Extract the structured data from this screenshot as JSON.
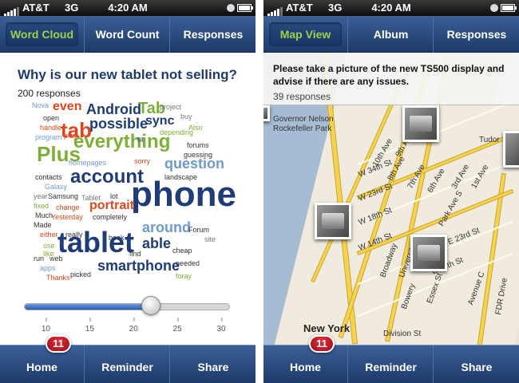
{
  "status": {
    "carrier": "AT&T",
    "network": "3G",
    "time": "4:20 AM"
  },
  "left": {
    "tabs": [
      {
        "label": "Word Cloud",
        "active": true
      },
      {
        "label": "Word Count",
        "active": false
      },
      {
        "label": "Responses",
        "active": false
      }
    ],
    "question": "Why is our new tablet not selling?",
    "responses": "200 responses",
    "cloud_words": [
      {
        "text": "Nova",
        "size": 9,
        "color": "#6d9bd1"
      },
      {
        "text": "even",
        "size": 16,
        "color": "#e0461c"
      },
      {
        "text": "Android",
        "size": 18,
        "color": "#1f3c78"
      },
      {
        "text": "Tab",
        "size": 20,
        "color": "#7db037"
      },
      {
        "text": "project",
        "size": 9,
        "color": "#7a7a7a"
      },
      {
        "text": "open",
        "size": 9,
        "color": "#333"
      },
      {
        "text": "handle",
        "size": 9,
        "color": "#e0461c"
      },
      {
        "text": "tab",
        "size": 26,
        "color": "#e0461c"
      },
      {
        "text": "possible",
        "size": 18,
        "color": "#1f3c78"
      },
      {
        "text": "sync",
        "size": 16,
        "color": "#1f3c78"
      },
      {
        "text": "buy",
        "size": 9,
        "color": "#7a7a7a"
      },
      {
        "text": "Also",
        "size": 9,
        "color": "#7db037"
      },
      {
        "text": "depending",
        "size": 9,
        "color": "#7db037"
      },
      {
        "text": "program",
        "size": 9,
        "color": "#6d9bd1"
      },
      {
        "text": "play",
        "size": 9,
        "color": "#e0461c"
      },
      {
        "text": "everything",
        "size": 24,
        "color": "#7db037"
      },
      {
        "text": "fill",
        "size": 8,
        "color": "#1f3c78"
      },
      {
        "text": "forums",
        "size": 9,
        "color": "#333"
      },
      {
        "text": "guessing",
        "size": 9,
        "color": "#333"
      },
      {
        "text": "Plus",
        "size": 26,
        "color": "#7db037"
      },
      {
        "text": "homepages",
        "size": 9,
        "color": "#6d9bd1"
      },
      {
        "text": "sorry",
        "size": 9,
        "color": "#e0461c"
      },
      {
        "text": "question",
        "size": 18,
        "color": "#6d9bd1"
      },
      {
        "text": "contacts",
        "size": 9,
        "color": "#333"
      },
      {
        "text": "account",
        "size": 24,
        "color": "#1f3c78"
      },
      {
        "text": "landscape",
        "size": 9,
        "color": "#333"
      },
      {
        "text": "Galaxy",
        "size": 9,
        "color": "#6d9bd1"
      },
      {
        "text": "year",
        "size": 9,
        "color": "#7a7a7a"
      },
      {
        "text": "fixed",
        "size": 9,
        "color": "#7db037"
      },
      {
        "text": "Samsung",
        "size": 9,
        "color": "#333"
      },
      {
        "text": "Tablet",
        "size": 9,
        "color": "#7a7a7a"
      },
      {
        "text": "lot",
        "size": 9,
        "color": "#333"
      },
      {
        "text": "phone",
        "size": 44,
        "color": "#1f3c78"
      },
      {
        "text": "Much",
        "size": 9,
        "color": "#333"
      },
      {
        "text": "change",
        "size": 9,
        "color": "#e0461c"
      },
      {
        "text": "portrait",
        "size": 16,
        "color": "#e0461c"
      },
      {
        "text": "Made",
        "size": 9,
        "color": "#333"
      },
      {
        "text": "Yesterday",
        "size": 9,
        "color": "#e0461c"
      },
      {
        "text": "completely",
        "size": 9,
        "color": "#333"
      },
      {
        "text": "either",
        "size": 9,
        "color": "#e0461c"
      },
      {
        "text": "really",
        "size": 9,
        "color": "#333"
      },
      {
        "text": "book",
        "size": 9,
        "color": "#333"
      },
      {
        "text": "around",
        "size": 18,
        "color": "#6d9bd1"
      },
      {
        "text": "Forum",
        "size": 9,
        "color": "#333"
      },
      {
        "text": "site",
        "size": 9,
        "color": "#7a7a7a"
      },
      {
        "text": "use",
        "size": 9,
        "color": "#7db037"
      },
      {
        "text": "like",
        "size": 9,
        "color": "#7db037"
      },
      {
        "text": "tablet",
        "size": 36,
        "color": "#1f3c78"
      },
      {
        "text": "find",
        "size": 9,
        "color": "#333"
      },
      {
        "text": "able",
        "size": 18,
        "color": "#1f3c78"
      },
      {
        "text": "cheap",
        "size": 9,
        "color": "#333"
      },
      {
        "text": "run",
        "size": 9,
        "color": "#333"
      },
      {
        "text": "web",
        "size": 9,
        "color": "#333"
      },
      {
        "text": "apps",
        "size": 9,
        "color": "#6d9bd1"
      },
      {
        "text": "needed",
        "size": 9,
        "color": "#333"
      },
      {
        "text": "Thanks",
        "size": 9,
        "color": "#e0461c"
      },
      {
        "text": "picked",
        "size": 9,
        "color": "#333"
      },
      {
        "text": "smartphone",
        "size": 18,
        "color": "#1f3c78"
      },
      {
        "text": "foray",
        "size": 9,
        "color": "#7db037"
      }
    ],
    "slider": {
      "value": 22,
      "min": 7.5,
      "max": 31,
      "ticks": [
        "10",
        "15",
        "20",
        "25",
        "30"
      ]
    },
    "bottom": {
      "home": "Home",
      "reminder": "Reminder",
      "share": "Share",
      "badge": "11"
    }
  },
  "right": {
    "tabs": [
      {
        "label": "Map View",
        "active": true
      },
      {
        "label": "Album",
        "active": false
      },
      {
        "label": "Responses",
        "active": false
      }
    ],
    "prompt": "Please take a picture of the new TS500 display and advise if there are any issues.",
    "responses": "39 responses",
    "map_labels": {
      "governor": "Governor Nelson",
      "rockefeller": "Rockefeller Park",
      "tudor": "Tudor",
      "new_york": "New York",
      "ave1": "1st Ave",
      "ave3": "3rd Ave",
      "ave6": "6th Ave",
      "ave7": "7th Ave",
      "ave8": "8th Ave",
      "ave9": "9th Ave",
      "ave10": "10th Ave",
      "park_ave": "Park Ave S",
      "w14": "W 14th St",
      "w18": "W 18th St",
      "w23": "W 23rd St",
      "w34": "W 34th St",
      "e14": "E 14th St",
      "e23": "E 23rd St",
      "broadway": "Broadway",
      "university": "University Pl",
      "bowery": "Bowery",
      "essex": "Essex St",
      "ave_c": "Avenue C",
      "fdr": "FDR Drive",
      "division": "Division St"
    },
    "bottom": {
      "home": "Home",
      "reminder": "Reminder",
      "share": "Share",
      "badge": "11"
    }
  }
}
